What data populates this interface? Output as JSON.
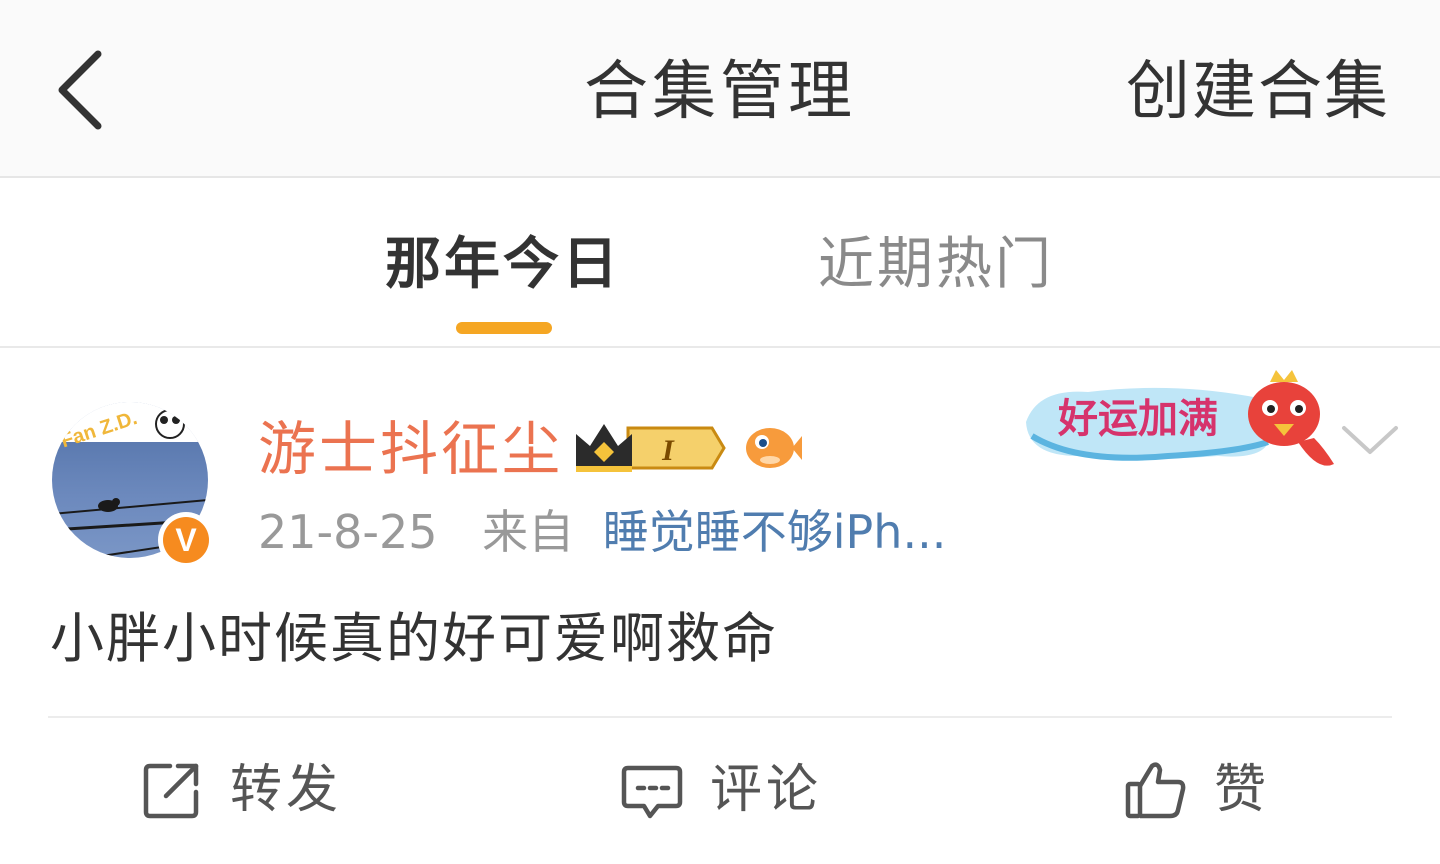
{
  "header": {
    "back_icon": "chevron-left-icon",
    "title": "合集管理",
    "create_label": "创建合集"
  },
  "tabs": [
    {
      "label": "那年今日",
      "active": true
    },
    {
      "label": "近期热门",
      "active": false
    }
  ],
  "accent_color": "#f5a623",
  "post": {
    "avatar": {
      "text": "Fan Z.D.",
      "verified_icon": "verified-v-icon",
      "verified_label": "V"
    },
    "username": "游士抖征尘",
    "username_color": "#eb7350",
    "badges": [
      {
        "icon": "crown-icon",
        "label": "I"
      },
      {
        "icon": "fish-icon"
      }
    ],
    "date": "21-8-25",
    "from_label": "来自",
    "source": "睡觉睡不够iPh...",
    "source_color": "#507daf",
    "sticker": {
      "icon": "good-luck-sticker",
      "text": "好运加满"
    },
    "more_icon": "chevron-down-icon",
    "text": "小胖小时候真的好可爱啊救命",
    "actions": [
      {
        "icon": "repost-icon",
        "label": "转发"
      },
      {
        "icon": "comment-icon",
        "label": "评论"
      },
      {
        "icon": "like-icon",
        "label": "赞"
      }
    ]
  }
}
